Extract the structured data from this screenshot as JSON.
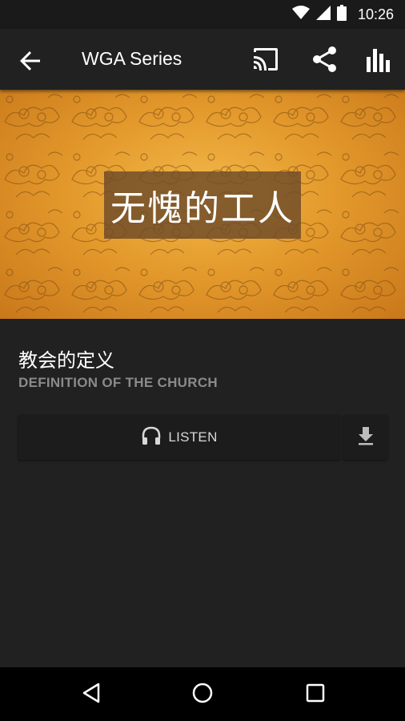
{
  "status_bar": {
    "time": "10:26"
  },
  "app_bar": {
    "title": "WGA Series",
    "actions": [
      "cast-icon",
      "share-icon",
      "stats-icon"
    ]
  },
  "hero": {
    "caption": "无愧的工人"
  },
  "episode": {
    "title": "教会的定义",
    "subtitle": "DEFINITION OF THE CHURCH"
  },
  "buttons": {
    "listen_label": "LISTEN"
  },
  "colors": {
    "background": "#212121",
    "app_bar": "#212121",
    "hero_gold": "#e49a2c",
    "subtitle_gray": "#8a8a8a",
    "nav_bar": "#000000"
  }
}
